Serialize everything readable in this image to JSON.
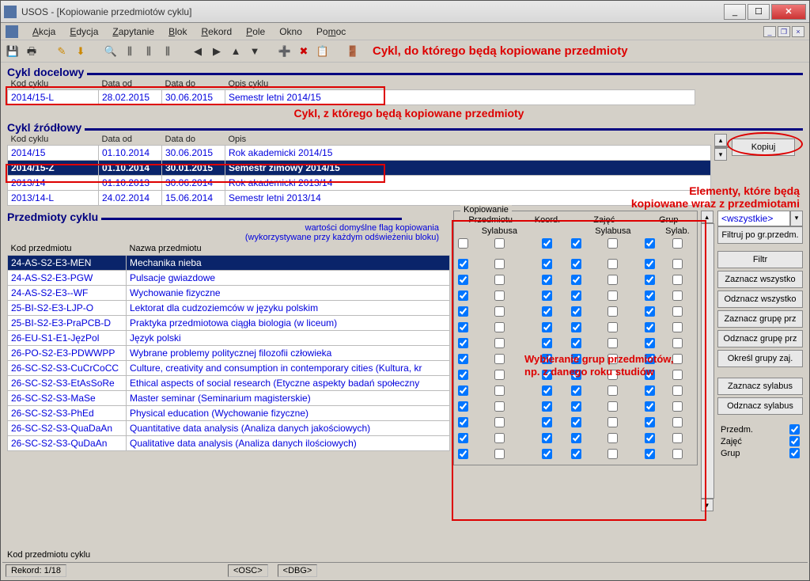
{
  "window": {
    "title": "USOS - [Kopiowanie przedmiotów cyklu]"
  },
  "menu": {
    "akcja": "Akcja",
    "edycja": "Edycja",
    "zapytanie": "Zapytanie",
    "blok": "Blok",
    "rekord": "Rekord",
    "pole": "Pole",
    "okno": "Okno",
    "pomoc": "Pomoc"
  },
  "annotations": {
    "top": "Cykl, do którego będą kopiowane przedmioty",
    "mid": "Cykl, z którego będą kopiowane przedmioty",
    "right1": "Elementy, które będą",
    "right2": "kopiowane wraz z przedmiotami",
    "groups1": "Wybieranie grup przedmiotów,",
    "groups2": "np. z danego roku studiów"
  },
  "sections": {
    "target": "Cykl docelowy",
    "source": "Cykl źródłowy",
    "subjects": "Przedmioty cyklu"
  },
  "target_headers": {
    "kod": "Kod cyklu",
    "od": "Data od",
    "do": "Data do",
    "opis": "Opis cyklu"
  },
  "target_row": {
    "kod": "2014/15-L",
    "od": "28.02.2015",
    "do": "30.06.2015",
    "opis": "Semestr letni 2014/15"
  },
  "source_headers": {
    "kod": "Kod cyklu",
    "od": "Data od",
    "do": "Data do",
    "opis": "Opis"
  },
  "source_rows": [
    {
      "kod": "2014/15",
      "od": "01.10.2014",
      "do": "30.06.2015",
      "opis": "Rok akademicki 2014/15",
      "selected": false
    },
    {
      "kod": "2014/15-Z",
      "od": "01.10.2014",
      "do": "30.01.2015",
      "opis": "Semestr zimowy 2014/15",
      "selected": true
    },
    {
      "kod": "2013/14",
      "od": "01.10.2013",
      "do": "30.06.2014",
      "opis": "Rok akademicki 2013/14",
      "selected": false
    },
    {
      "kod": "2013/14-L",
      "od": "24.02.2014",
      "do": "15.06.2014",
      "opis": "Semestr letni 2013/14",
      "selected": false
    }
  ],
  "kopiuj_label": "Kopiuj",
  "kop_group": {
    "legend": "Kopiowanie",
    "h1": "Przedmiotu",
    "h2": "Koord.",
    "h3": "Zajęć",
    "h4": "Grup",
    "s1": "Sylabusa",
    "s2": "Sylabusa",
    "s3": "Sylab."
  },
  "note1": "wartości domyślne flag kopiowania",
  "note2": "(wykorzystywane przy każdym odświeżeniu bloku)",
  "subj_headers": {
    "kod": "Kod przedmiotu",
    "nazwa": "Nazwa przedmiotu"
  },
  "subjects": [
    {
      "kod": "24-AS-S2-E3-MEN",
      "nazwa": "Mechanika nieba",
      "sel": true
    },
    {
      "kod": "24-AS-S2-E3-PGW",
      "nazwa": "Pulsacje gwiazdowe"
    },
    {
      "kod": "24-AS-S2-E3--WF",
      "nazwa": "Wychowanie fizyczne"
    },
    {
      "kod": "25-BI-S2-E3-LJP-O",
      "nazwa": "Lektorat dla cudzoziemców w języku polskim"
    },
    {
      "kod": "25-BI-S2-E3-PraPCB-D",
      "nazwa": "Praktyka przedmiotowa ciągła biologia (w liceum)"
    },
    {
      "kod": "26-EU-S1-E1-JęzPol",
      "nazwa": "Język polski"
    },
    {
      "kod": "26-PO-S2-E3-PDWWPP",
      "nazwa": "Wybrane problemy politycznej filozofii człowieka"
    },
    {
      "kod": "26-SC-S2-S3-CuCrCoCC",
      "nazwa": "Culture, creativity and consumption in contemporary cities (Kultura, kr"
    },
    {
      "kod": "26-SC-S2-S3-EtAsSoRe",
      "nazwa": "Ethical aspects of social research (Etyczne aspekty badań społeczny"
    },
    {
      "kod": "26-SC-S2-S3-MaSe",
      "nazwa": "Master seminar (Seminarium magisterskie)"
    },
    {
      "kod": "26-SC-S2-S3-PhEd",
      "nazwa": "Physical education (Wychowanie fizyczne)"
    },
    {
      "kod": "26-SC-S2-S3-QuaDaAn",
      "nazwa": "Quantitative data analysis (Analiza danych jakościowych)"
    },
    {
      "kod": "26-SC-S2-S3-QuDaAn",
      "nazwa": "Qualitative data analysis (Analiza danych ilościowych)"
    }
  ],
  "side": {
    "wszystkie": "<wszystkie>",
    "filtruj": "Filtruj po gr.przedm.",
    "filtr": "Filtr",
    "zazn_w": "Zaznacz wszystko",
    "odzn_w": "Odznacz wszystko",
    "zazn_g": "Zaznacz grupę prz",
    "odzn_g": "Odznacz grupę prz",
    "okresl": "Określ grupy zaj.",
    "zazn_s": "Zaznacz sylabus",
    "odzn_s": "Odznacz sylabus",
    "przedm": "Przedm.",
    "zajec": "Zajęć",
    "grup": "Grup"
  },
  "footer": {
    "kod": "Kod przedmiotu cyklu",
    "rekord": "Rekord: 1/18",
    "osc": "<OSC>",
    "dbg": "<DBG>"
  }
}
